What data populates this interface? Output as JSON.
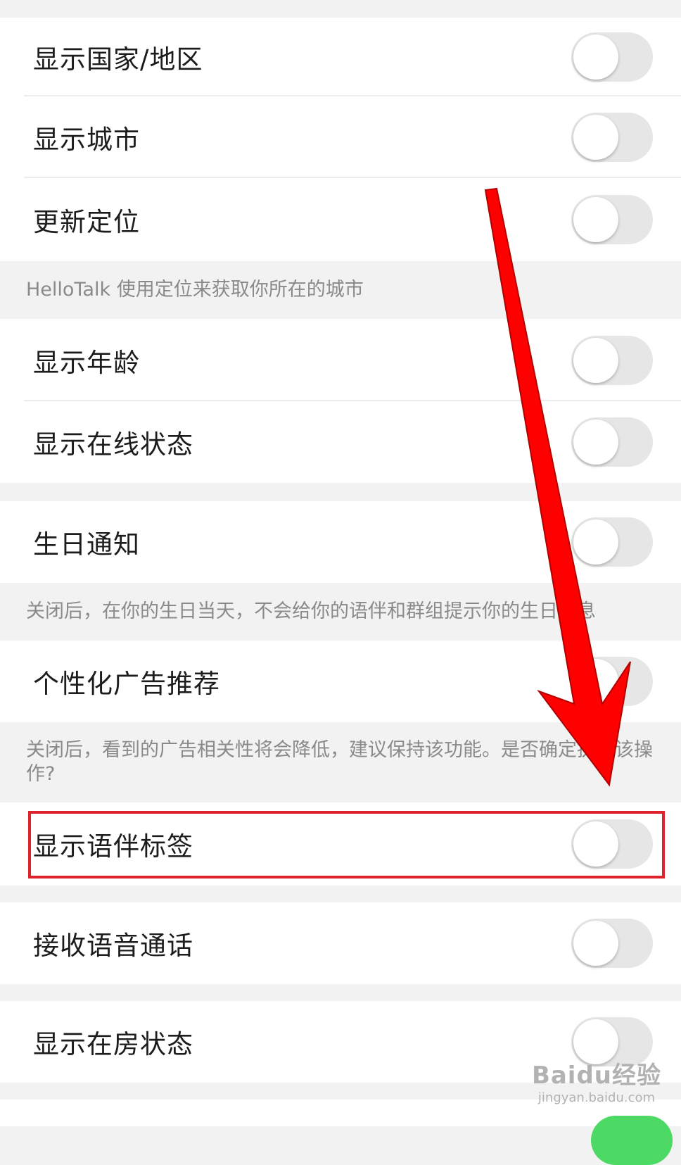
{
  "settings": [
    {
      "label": "显示国家/地区",
      "on": false
    },
    {
      "label": "显示城市",
      "on": false
    },
    {
      "label": "更新定位",
      "on": false
    },
    {
      "label": "显示年龄",
      "on": false
    },
    {
      "label": "显示在线状态",
      "on": false
    },
    {
      "label": "生日通知",
      "on": false
    },
    {
      "label": "个性化广告推荐",
      "on": false
    },
    {
      "label": "显示语伴标签",
      "on": false
    },
    {
      "label": "接收语音通话",
      "on": false
    },
    {
      "label": "显示在房状态",
      "on": false
    }
  ],
  "notes": {
    "location": "HelloTalk 使用定位来获取你所在的城市",
    "birthday": "关闭后，在你的生日当天，不会给你的语伴和群组提示你的生日信息",
    "ads": "关闭后，看到的广告相关性将会降低，建议保持该功能。是否确定执行该操作?"
  },
  "watermark": {
    "brand": "Baidu经验",
    "sub": "jingyan.baidu.com"
  },
  "colors": {
    "highlight": "#e0232b",
    "arrow": "#ff0000",
    "toggle_off": "#e6e6e6",
    "toggle_on": "#4cd964"
  }
}
